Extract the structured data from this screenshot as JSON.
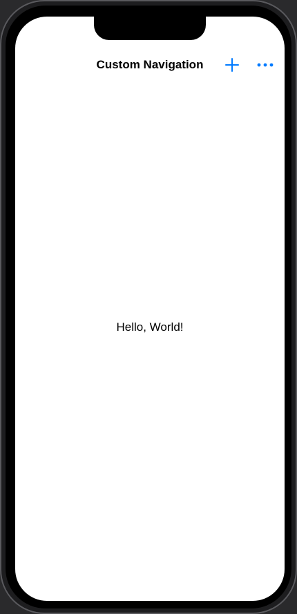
{
  "nav": {
    "title": "Custom Navigation",
    "add_icon": "plus-icon",
    "more_icon": "ellipsis-icon",
    "accent_color": "#007AFF"
  },
  "content": {
    "text": "Hello, World!"
  }
}
